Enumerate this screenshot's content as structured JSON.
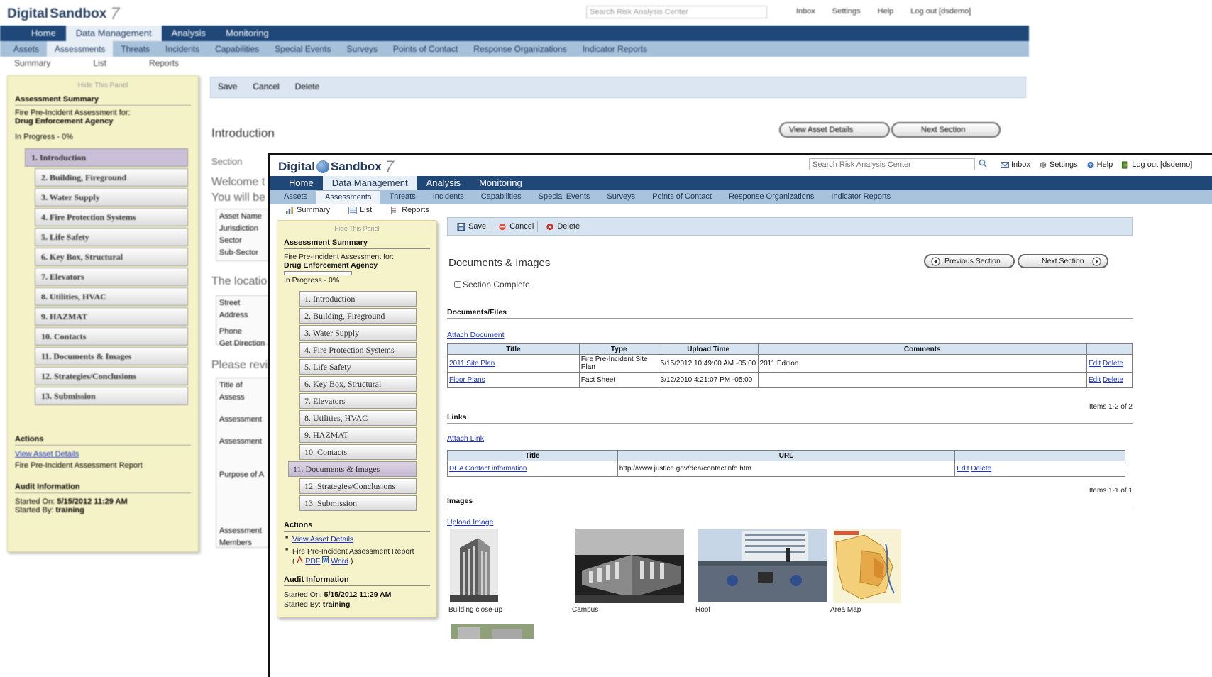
{
  "app": {
    "logo_text": "Digital",
    "logo_text2": "Sandbox",
    "logo_version": "7",
    "search_placeholder": "Search Risk Analysis Center",
    "toplinks": [
      "Inbox",
      "Settings",
      "Help",
      "Log out [dsdemo]"
    ]
  },
  "nav": {
    "primary": [
      "Home",
      "Data Management",
      "Analysis",
      "Monitoring"
    ],
    "primary_active": 1,
    "secondary": [
      "Assets",
      "Assessments",
      "Threats",
      "Incidents",
      "Capabilities",
      "Special Events",
      "Surveys",
      "Points of Contact",
      "Response Organizations",
      "Indicator Reports"
    ],
    "secondary_active": 1,
    "tertiary": [
      "Summary",
      "List",
      "Reports"
    ]
  },
  "panel": {
    "hide_label": "Hide This Panel",
    "summary_heading": "Assessment Summary",
    "assessment_for": "Fire Pre-Incident Assessment for:",
    "agency": "Drug Enforcement Agency",
    "progress_text": "In Progress - 0%",
    "progress_value": 0,
    "sections": [
      "1. Introduction",
      "2. Building, Fireground",
      "3. Water Supply",
      "4. Fire Protection Systems",
      "5. Life Safety",
      "6. Key Box, Structural",
      "7. Elevators",
      "8. Utilities, HVAC",
      "9. HAZMAT",
      "10. Contacts",
      "11. Documents & Images",
      "12. Strategies/Conclusions",
      "13. Submission"
    ],
    "active_section": 10,
    "actions_heading": "Actions",
    "view_asset_details": "View Asset Details",
    "report_label": "Fire Pre-Incident Assessment Report",
    "pdf": "PDF",
    "word": "Word",
    "open_paren": "(",
    "close_paren": ")",
    "audit_heading": "Audit Information",
    "started_on_label": "Started On:",
    "started_on": "5/15/2012 11:29 AM",
    "started_by_label": "Started By:",
    "started_by": "training"
  },
  "toolbar": {
    "save": "Save",
    "cancel": "Cancel",
    "delete": "Delete"
  },
  "main": {
    "section_title": "Documents & Images",
    "prev_section": "Previous Section",
    "next_section": "Next Section",
    "section_complete": "Section Complete",
    "documents": {
      "heading": "Documents/Files",
      "attach_label": "Attach Document",
      "columns": [
        "Title",
        "Type",
        "Upload Time",
        "Comments"
      ],
      "rows": [
        {
          "title": "2011 Site Plan",
          "type": "Fire Pre-Incident Site Plan",
          "upload_time": "5/15/2012 10:49:00 AM -05:00",
          "comments": "2011 Edition",
          "edit": "Edit",
          "delete": "Delete"
        },
        {
          "title": "Floor Plans",
          "type": "Fact Sheet",
          "upload_time": "3/12/2010 4:21:07 PM -05:00",
          "comments": "",
          "edit": "Edit",
          "delete": "Delete"
        }
      ],
      "count": "Items 1-2 of 2"
    },
    "links": {
      "heading": "Links",
      "attach_label": "Attach Link",
      "columns": [
        "Title",
        "URL"
      ],
      "rows": [
        {
          "title": "DEA Contact information",
          "url": "http://www.justice.gov/dea/contactinfo.htm",
          "edit": "Edit",
          "delete": "Delete"
        }
      ],
      "count": "Items 1-1 of 1"
    },
    "images": {
      "heading": "Images",
      "upload_label": "Upload Image",
      "items": [
        {
          "caption": "Building close-up"
        },
        {
          "caption": "Campus"
        },
        {
          "caption": "Roof"
        },
        {
          "caption": "Area Map"
        }
      ]
    }
  },
  "back_window": {
    "section_title": "Introduction",
    "next_section": "Next Section",
    "view_asset_details": "View Asset Details",
    "section_complete": "Section",
    "fragments": [
      "Welcome t",
      "You will be",
      "The locatio",
      "Please revi"
    ],
    "fields_a": [
      "Asset Name",
      "Jurisdiction",
      "Sector",
      "Sub-Sector"
    ],
    "fields_b": [
      "Street Address",
      "Phone",
      "Get Direction"
    ],
    "fields_c": [
      "Title of Assess",
      "Assessment",
      "Assessment",
      "Purpose of A",
      "Assessment Members"
    ]
  },
  "colors": {
    "nav_primary": "#1f4778",
    "nav_secondary": "#a9c2dc",
    "panel_bg": "#f6f3cb",
    "toolbar_bg": "#d6e3f1",
    "link": "#1a33cc"
  }
}
